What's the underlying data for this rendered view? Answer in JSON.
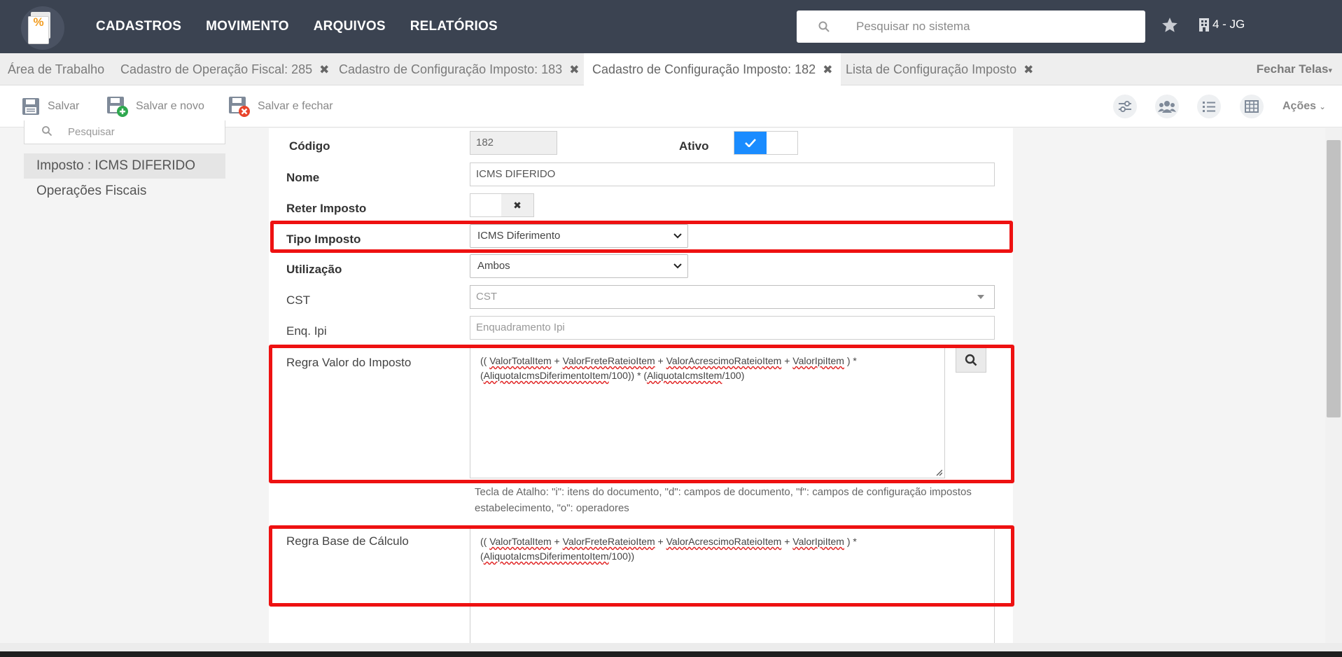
{
  "nav": {
    "menu": [
      "CADASTROS",
      "MOVIMENTO",
      "ARQUIVOS",
      "RELATÓRIOS"
    ],
    "search_placeholder": "Pesquisar no sistema",
    "company": "4 - JG"
  },
  "tabs": {
    "items": [
      {
        "label": "Área de Trabalho",
        "closable": false
      },
      {
        "label": "Cadastro de Operação Fiscal: 285",
        "closable": true
      },
      {
        "label": "Cadastro de Configuração Imposto: 183",
        "closable": true
      },
      {
        "label": "Cadastro de Configuração Imposto: 182",
        "closable": true,
        "active": true
      },
      {
        "label": "Lista de Configuração Imposto",
        "closable": true
      }
    ],
    "close_all": "Fechar Telas"
  },
  "toolbar": {
    "save": "Salvar",
    "save_new": "Salvar e novo",
    "save_close": "Salvar e fechar",
    "actions": "Ações"
  },
  "left_panel": {
    "search_placeholder": "Pesquisar",
    "items": [
      "Imposto : ICMS DIFERIDO",
      "Operações Fiscais"
    ]
  },
  "form": {
    "codigo_label": "Código",
    "codigo_value": "182",
    "ativo_label": "Ativo",
    "nome_label": "Nome",
    "nome_value": "ICMS DIFERIDO",
    "reter_label": "Reter Imposto",
    "tipo_label": "Tipo Imposto",
    "tipo_value": "ICMS Diferimento",
    "utilizacao_label": "Utilização",
    "utilizacao_value": "Ambos",
    "cst_label": "CST",
    "cst_placeholder": "CST",
    "enq_label": "Enq. Ipi",
    "enq_placeholder": "Enquadramento Ipi",
    "regra_valor_label": "Regra Valor do Imposto",
    "regra_valor": {
      "t0": "(( ",
      "t1": "ValorTotalItem",
      "t2": " + ",
      "t3": "ValorFreteRateioItem",
      "t4": " + ",
      "t5": "ValorAcrescimoRateioItem",
      "t6": " + ",
      "t7": "ValorIpiItem",
      "t8": " ) *",
      "t9": "(",
      "t10": "AliquotaIcmsDiferimentoItem",
      "t11": "/100)) * (",
      "t12": "AliquotaIcmsItem",
      "t13": "/100)"
    },
    "hint": "Tecla de Atalho: \"i\": itens do documento, \"d\": campos de documento, \"f\": campos de configuração impostos estabelecimento, \"o\": operadores",
    "regra_base_label": "Regra Base de Cálculo",
    "regra_base": {
      "t0": "(( ",
      "t1": "ValorTotalItem",
      "t2": " + ",
      "t3": "ValorFreteRateioItem",
      "t4": " + ",
      "t5": "ValorAcrescimoRateioItem",
      "t6": " + ",
      "t7": "ValorIpiItem",
      "t8": " ) *",
      "t9": "(",
      "t10": "AliquotaIcmsDiferimentoItem",
      "t11": "/100))"
    }
  },
  "colors": {
    "topbar": "#3b4351",
    "highlight": "#ee1111",
    "toggle_on": "#1a8cff"
  }
}
